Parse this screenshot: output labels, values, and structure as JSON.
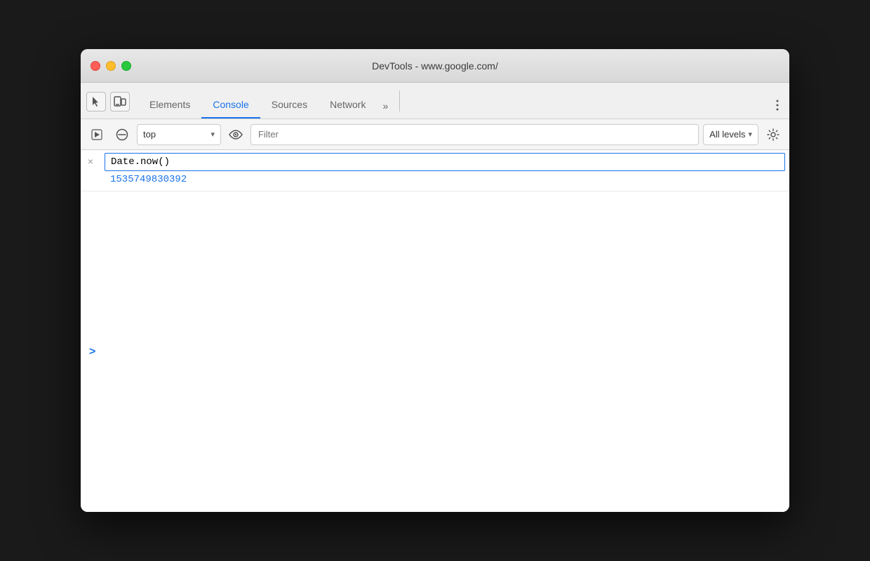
{
  "window": {
    "title": "DevTools - www.google.com/"
  },
  "traffic_lights": {
    "close_label": "close",
    "minimize_label": "minimize",
    "maximize_label": "maximize"
  },
  "tabs": [
    {
      "id": "elements",
      "label": "Elements",
      "active": false
    },
    {
      "id": "console",
      "label": "Console",
      "active": true
    },
    {
      "id": "sources",
      "label": "Sources",
      "active": false
    },
    {
      "id": "network",
      "label": "Network",
      "active": false
    },
    {
      "id": "more",
      "label": "»",
      "active": false
    }
  ],
  "toolbar": {
    "select_context": "top",
    "select_arrow": "▾",
    "filter_placeholder": "Filter",
    "all_levels_label": "All levels",
    "all_levels_arrow": "▾"
  },
  "console": {
    "input_value": "Date.now()",
    "result_value": "1535749830392",
    "close_symbol": "×",
    "chevron_symbol": ">"
  }
}
